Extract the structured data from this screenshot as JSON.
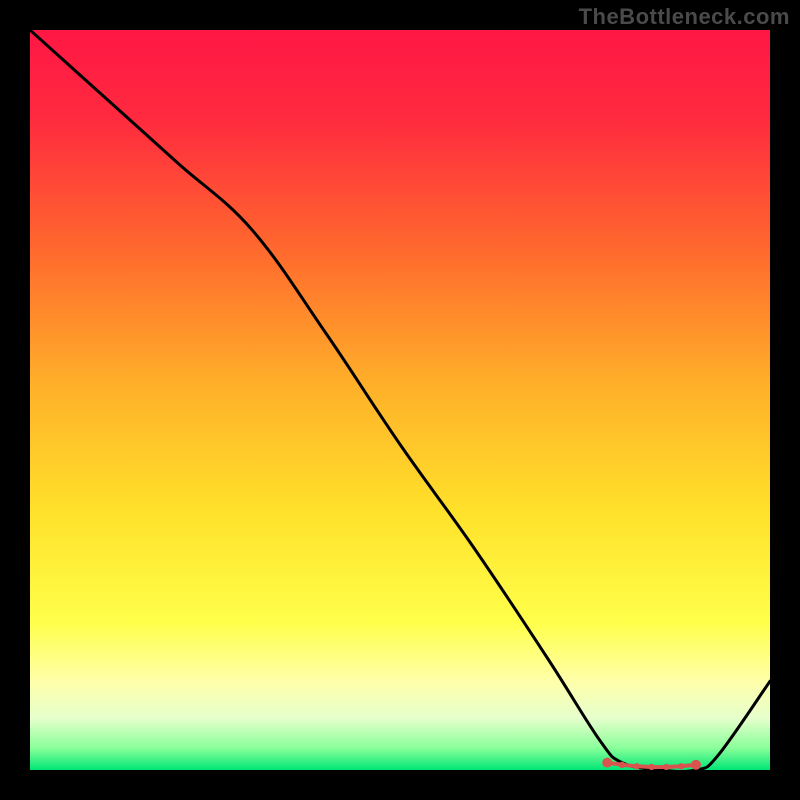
{
  "watermark": "TheBottleneck.com",
  "chart_data": {
    "type": "line",
    "title": "",
    "xlabel": "",
    "ylabel": "",
    "xlim": [
      0,
      100
    ],
    "ylim": [
      0,
      100
    ],
    "grid": false,
    "legend": false,
    "background_gradient": {
      "stops": [
        {
          "offset": 0.0,
          "color": "#ff1744"
        },
        {
          "offset": 0.12,
          "color": "#ff2a3f"
        },
        {
          "offset": 0.3,
          "color": "#ff6a2d"
        },
        {
          "offset": 0.48,
          "color": "#ffb029"
        },
        {
          "offset": 0.65,
          "color": "#ffe12a"
        },
        {
          "offset": 0.8,
          "color": "#ffff4a"
        },
        {
          "offset": 0.88,
          "color": "#ffffaa"
        },
        {
          "offset": 0.93,
          "color": "#e6ffcc"
        },
        {
          "offset": 0.97,
          "color": "#8aff9a"
        },
        {
          "offset": 1.0,
          "color": "#00e676"
        }
      ]
    },
    "series": [
      {
        "name": "curve",
        "x": [
          0,
          10,
          20,
          30,
          40,
          50,
          60,
          70,
          77,
          80,
          85,
          90,
          93,
          100
        ],
        "y": [
          100,
          91,
          82,
          73,
          59,
          44,
          30,
          15,
          4,
          1,
          0,
          0,
          2,
          12
        ]
      }
    ],
    "markers": {
      "note": "dotted red segment near minimum",
      "x": [
        78,
        80,
        82,
        84,
        86,
        88,
        90
      ],
      "y": [
        1,
        0.7,
        0.5,
        0.4,
        0.4,
        0.5,
        0.7
      ],
      "color": "#d9534f"
    }
  }
}
